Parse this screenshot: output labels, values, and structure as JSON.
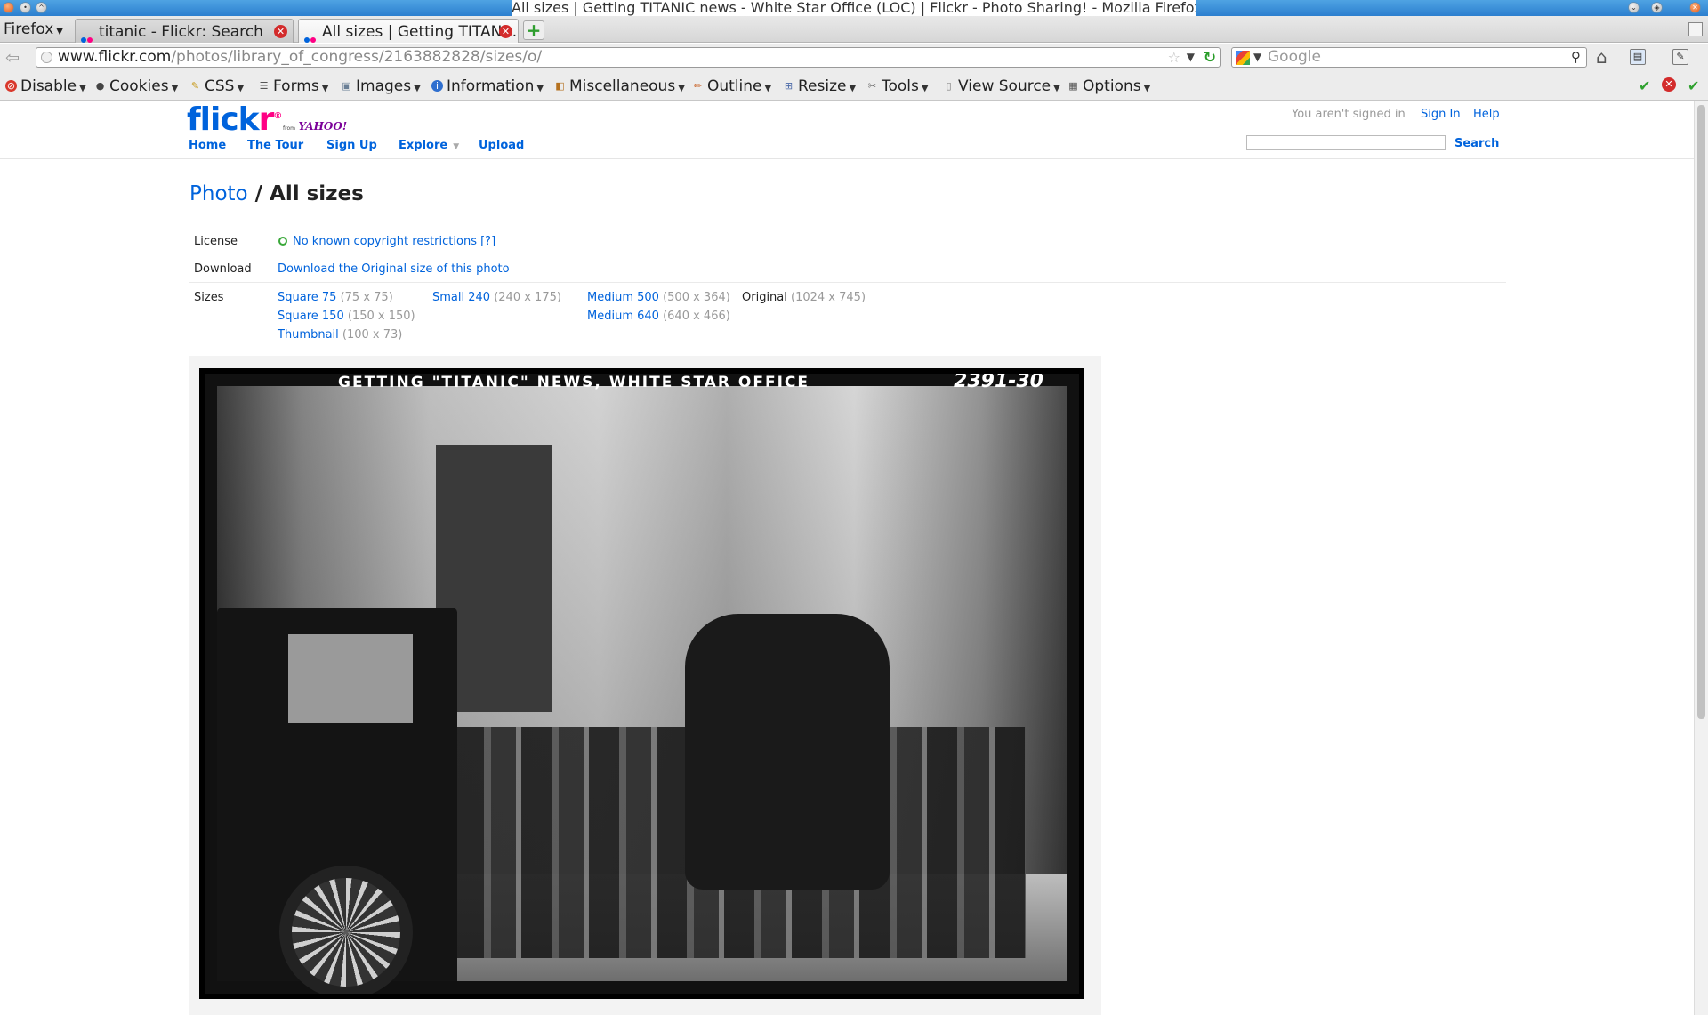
{
  "window": {
    "title": "All sizes | Getting TITANIC news - White Star Office (LOC) | Flickr - Photo Sharing! - Mozilla Firefox"
  },
  "browser": {
    "menu_button": "Firefox",
    "tabs": [
      {
        "label": "titanic - Flickr: Search",
        "active": false
      },
      {
        "label": "All sizes | Getting TITAN…",
        "active": true
      }
    ],
    "url_host": "www.flickr.com",
    "url_path": "/photos/library_of_congress/2163882828/sizes/o/",
    "search_placeholder": "Google"
  },
  "devtoolbar": {
    "items": [
      {
        "label": "Disable",
        "icon": "disable-icon",
        "color": "#d9382c"
      },
      {
        "label": "Cookies",
        "icon": "cookies-icon",
        "color": "#444444"
      },
      {
        "label": "CSS",
        "icon": "css-icon",
        "color": "#c79a1b"
      },
      {
        "label": "Forms",
        "icon": "forms-icon",
        "color": "#555555"
      },
      {
        "label": "Images",
        "icon": "images-icon",
        "color": "#6a7f96"
      },
      {
        "label": "Information",
        "icon": "information-icon",
        "color": "#2f6fcf"
      },
      {
        "label": "Miscellaneous",
        "icon": "miscellaneous-icon",
        "color": "#b5711f"
      },
      {
        "label": "Outline",
        "icon": "outline-icon",
        "color": "#c75a1b"
      },
      {
        "label": "Resize",
        "icon": "resize-icon",
        "color": "#4b6aa8"
      },
      {
        "label": "Tools",
        "icon": "tools-icon",
        "color": "#555555"
      },
      {
        "label": "View Source",
        "icon": "view-source-icon",
        "color": "#777777"
      },
      {
        "label": "Options",
        "icon": "options-icon",
        "color": "#555555"
      }
    ]
  },
  "header": {
    "logo_flick": "flick",
    "logo_r": "r",
    "logo_reg": "®",
    "from_label": "from",
    "yahoo_label": "YAHOO!",
    "nav": [
      "Home",
      "The Tour",
      "Sign Up",
      "Explore",
      "Upload"
    ],
    "signed_out_text": "You aren't signed in",
    "sign_in": "Sign In",
    "help": "Help",
    "search_button": "Search"
  },
  "main": {
    "title_link": "Photo",
    "title_sep": " / ",
    "title_rest": "All sizes",
    "license_label": "License",
    "license_value": "No known copyright restrictions",
    "license_help": "[?]",
    "download_label": "Download",
    "download_link": "Download the Original size of this photo",
    "sizes_label": "Sizes",
    "sizes": [
      {
        "name": "Square 75",
        "dims": "(75 x 75)",
        "link": true
      },
      {
        "name": "Square 150",
        "dims": "(150 x 150)",
        "link": true
      },
      {
        "name": "Thumbnail",
        "dims": "(100 x 73)",
        "link": true
      },
      {
        "name": "Small 240",
        "dims": "(240 x 175)",
        "link": true
      },
      {
        "name": "Medium 500",
        "dims": "(500 x 364)",
        "link": true
      },
      {
        "name": "Medium 640",
        "dims": "(640 x 466)",
        "link": true
      },
      {
        "name": "Original",
        "dims": "(1024 x 745)",
        "link": false
      }
    ],
    "photo_caption": "GETTING \"TITANIC\" NEWS, WHITE STAR OFFICE",
    "photo_number": "2391-30"
  }
}
